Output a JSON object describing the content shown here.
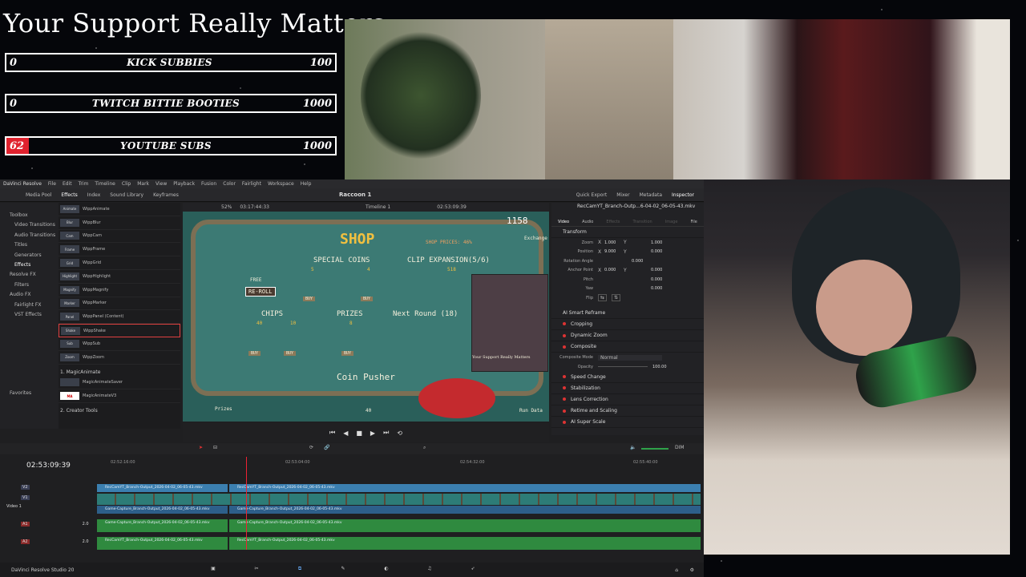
{
  "goals": {
    "title": "Your Support Really Matters",
    "bars": [
      {
        "current": "0",
        "label": "KICK SUBBIES",
        "target": "100",
        "progress": 0
      },
      {
        "current": "0",
        "label": "TWITCH BITTIE BOOTIES",
        "target": "1000",
        "progress": 0
      },
      {
        "current": "62",
        "label": "YOUTUBE SUBS",
        "target": "1000",
        "progress": 0.062
      }
    ]
  },
  "resolve": {
    "app_name": "DaVinci Resolve",
    "menu": [
      "File",
      "Edit",
      "Trim",
      "Timeline",
      "Clip",
      "Mark",
      "View",
      "Playback",
      "Fusion",
      "Color",
      "Fairlight",
      "Workspace",
      "Help"
    ],
    "toolbar": {
      "left": [
        "Media Pool",
        "Effects",
        "Index",
        "Sound Library",
        "Keyframes"
      ],
      "project": "Raccoon 1",
      "right": [
        "Quick Export",
        "Mixer",
        "Metadata",
        "Inspector"
      ]
    },
    "fx_tree": [
      "Toolbox",
      "Video Transitions",
      "Audio Transitions",
      "Titles",
      "Generators",
      "Effects",
      "Resolve FX",
      "Filters",
      "Audio FX",
      "Fairlight FX",
      "VST Effects"
    ],
    "favorites_label": "Favorites",
    "fx_items": [
      {
        "thumb": "Animate",
        "label": "WippAnimate"
      },
      {
        "thumb": "Blur",
        "label": "WippBlur"
      },
      {
        "thumb": "Cam",
        "label": "WippCam"
      },
      {
        "thumb": "Frame",
        "label": "WippFrame"
      },
      {
        "thumb": "Grid",
        "label": "WippGrid"
      },
      {
        "thumb": "Highlight",
        "label": "WippHighlight"
      },
      {
        "thumb": "Magnify",
        "label": "WippMagnify"
      },
      {
        "thumb": "Marker",
        "label": "WippMarker"
      },
      {
        "thumb": "Panel",
        "label": "WippPanel (Content)"
      },
      {
        "thumb": "Shake",
        "label": "WippShake",
        "active": true
      },
      {
        "thumb": "Sub",
        "label": "WippSub"
      },
      {
        "thumb": "Zoom",
        "label": "WippZoom"
      }
    ],
    "fx_section_1": "1. MagicAnimate",
    "magic_items": [
      "MagicAnimateSaver",
      "MagicAnimateV3"
    ],
    "fx_section_2": "2. Creator Tools",
    "viewer": {
      "zoom": "52%",
      "timecode_left": "03:17:44:33",
      "timeline_name": "Timeline 1",
      "timecode_right": "02:53:09:39"
    },
    "game": {
      "shop": "SHOP",
      "shop_prices": "SHOP PRICES: 46%",
      "coins": "1158",
      "exchange": "Exchange",
      "special_coins": "SPECIAL COINS",
      "clip_expansion": "CLIP EXPANSION(5/6)",
      "free": "FREE",
      "reroll": "RE-ROLL",
      "chips": "CHIPS",
      "prizes": "PRIZES",
      "next_round": "Next Round (18)",
      "coin_pusher": "Coin Pusher",
      "prizes_btn": "Prizes",
      "run_data": "Run Data",
      "inset_text": "Your Support Really Matters",
      "price_5": "5",
      "price_4": "4",
      "price_518": "518",
      "price_40": "40",
      "price_10": "10",
      "price_8": "8",
      "bottom_count": "40",
      "buy": "BUY"
    },
    "inspector": {
      "file_name": "RecCamYT_Branch-Outp...6-04-02_06-05-43.mkv",
      "tabs": [
        "Video",
        "Audio",
        "Effects",
        "Transition",
        "Image",
        "File"
      ],
      "transform_title": "Transform",
      "transform": [
        {
          "label": "Zoom",
          "x": "1.000",
          "y": "1.000"
        },
        {
          "label": "Position",
          "x": "9.000",
          "y": "0.000"
        },
        {
          "label": "Rotation Angle",
          "x": "0.000",
          "y": ""
        },
        {
          "label": "Anchor Point",
          "x": "0.000",
          "y": "0.000"
        },
        {
          "label": "Pitch",
          "x": "",
          "y": "0.000"
        },
        {
          "label": "Yaw",
          "x": "",
          "y": "0.000"
        },
        {
          "label": "Flip",
          "x": "",
          "y": ""
        }
      ],
      "sections_a": [
        "AI Smart Reframe",
        "Cropping",
        "Dynamic Zoom",
        "Composite"
      ],
      "composite_mode_label": "Composite Mode",
      "composite_mode": "Normal",
      "opacity_label": "Opacity",
      "opacity": "100.00",
      "sections_b": [
        "Speed Change",
        "Stabilization",
        "Lens Correction",
        "Retime and Scaling",
        "AI Super Scale"
      ]
    },
    "timeline": {
      "timecode": "02:53:09:39",
      "ruler": [
        "02:52:16:00",
        "02:53:04:00",
        "02:54:32:00",
        "02:55:40:00"
      ],
      "tracks": [
        {
          "id": "V2",
          "name": ""
        },
        {
          "id": "V1",
          "name": "Video 1"
        },
        {
          "id": "A1",
          "name": "",
          "level": "2.0"
        },
        {
          "id": "A2",
          "name": "",
          "level": "2.0"
        }
      ],
      "clips": {
        "v2_a": "RecCamYT_Branch-Output_2026-04-02_06-05-43.mkv",
        "v2_b": "RecCamYT_Branch-Output_2026-04-02_06-05-43.mkv",
        "v1_a": "Game-Capture_Branch-Output_2026-04-02_06-05-43.mkv",
        "v1_b": "Game-Capture_Branch-Output_2026-04-02_06-05-43.mkv",
        "a1_a": "Game-Capture_Branch-Output_2026-04-02_06-05-43.mkv",
        "a1_b": "Game-Capture_Branch-Output_2026-04-02_06-05-43.mkv",
        "a2_a": "RecCamYT_Branch-Output_2026-04-02_06-05-43.mkv",
        "a2_b": "RecCamYT_Branch-Output_2026-04-02_06-05-43.mkv"
      },
      "audio_meter": "DIM"
    },
    "footer": "DaVinci Resolve Studio 20"
  }
}
